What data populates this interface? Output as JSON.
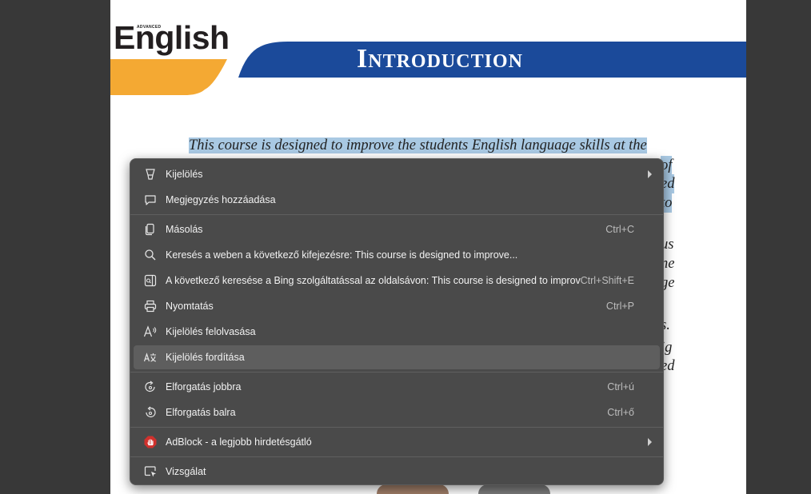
{
  "page": {
    "logo_advanced": "ADVANCED",
    "logo_word": "English",
    "banner_title_first": "I",
    "banner_title_rest": "NTRODUCTION",
    "para_line1": "This course is designed to improve the students English language skills at the",
    "right_fragments": [
      "of",
      "ed",
      "to",
      "us",
      "ne",
      "ge",
      "s.",
      "ig",
      "ed"
    ]
  },
  "colors": {
    "banner_blue": "#1b4a9a",
    "logo_orange": "#f4a933",
    "selection_highlight": "#a9c9e3",
    "menu_bg": "#4a4a4a"
  },
  "menu": {
    "items": [
      {
        "label": "Kijelölés",
        "shortcut": "",
        "icon": "highlighter-icon",
        "submenu": true
      },
      {
        "label": "Megjegyzés hozzáadása",
        "shortcut": "",
        "icon": "comment-icon"
      },
      {
        "label": "Másolás",
        "shortcut": "Ctrl+C",
        "icon": "copy-icon"
      },
      {
        "label": "Keresés a weben a következő kifejezésre: This course is designed to improve...",
        "shortcut": "",
        "icon": "search-icon"
      },
      {
        "label": "A következő keresése a Bing szolgáltatással az oldalsávon: This course is designed to improve...",
        "shortcut": "Ctrl+Shift+E",
        "icon": "sidebar-search-icon"
      },
      {
        "label": "Nyomtatás",
        "shortcut": "Ctrl+P",
        "icon": "print-icon"
      },
      {
        "label": "Kijelölés felolvasása",
        "shortcut": "",
        "icon": "read-aloud-icon"
      },
      {
        "label": "Kijelölés fordítása",
        "shortcut": "",
        "icon": "translate-icon",
        "active": true
      },
      {
        "label": "Elforgatás jobbra",
        "shortcut": "Ctrl+ú",
        "icon": "rotate-right-icon"
      },
      {
        "label": "Elforgatás balra",
        "shortcut": "Ctrl+ő",
        "icon": "rotate-left-icon"
      },
      {
        "label": "AdBlock - a legjobb hirdetésgátló",
        "shortcut": "",
        "icon": "adblock-icon",
        "submenu": true
      },
      {
        "label": "Vizsgálat",
        "shortcut": "",
        "icon": "inspect-icon"
      }
    ]
  }
}
